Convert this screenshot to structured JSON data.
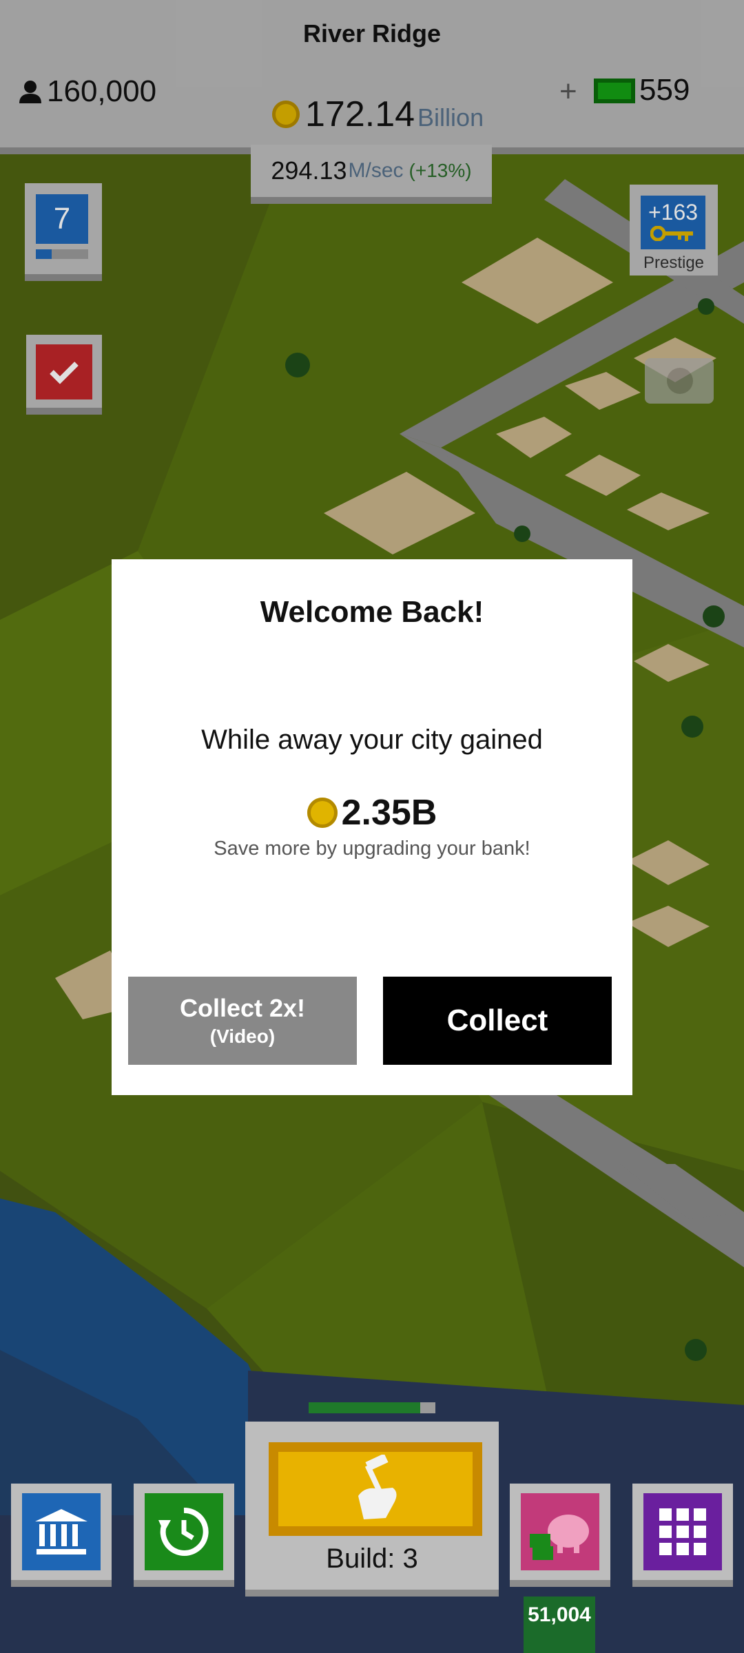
{
  "header": {
    "city_name": "River Ridge",
    "population": "160,000",
    "money_value": "172.14",
    "money_unit": "Billion",
    "rate_value": "294.13",
    "rate_unit": "M/sec",
    "rate_bonus": "(+13%)",
    "plus_label": "+",
    "cash_value": "559"
  },
  "left_buttons": {
    "level": "7",
    "level_progress": 0.3,
    "tasks_icon": "check-icon"
  },
  "prestige": {
    "value": "+163",
    "label": "Prestige"
  },
  "dialog": {
    "title": "Welcome Back!",
    "message": "While away your city gained",
    "amount": "2.35B",
    "hint": "Save more by upgrading your bank!",
    "collect_video_line1": "Collect 2x!",
    "collect_video_line2": "(Video)",
    "collect_label": "Collect"
  },
  "bottom": {
    "build_label": "Build: 3",
    "build_progress": 0.88,
    "bank_count": "51,004",
    "icons": [
      "bank-icon",
      "history-icon",
      "build-icon",
      "piggy-bank-icon",
      "grid-menu-icon"
    ]
  },
  "colors": {
    "level_blue": "#1e66b5",
    "task_red": "#c0262a",
    "coin_gold": "#e0b400",
    "cash_green": "#14a014",
    "build_yellow": "#e8b200",
    "piggy_pink": "#c23a7a",
    "grid_purple": "#6a1f9e",
    "history_green": "#1a8a1a"
  }
}
